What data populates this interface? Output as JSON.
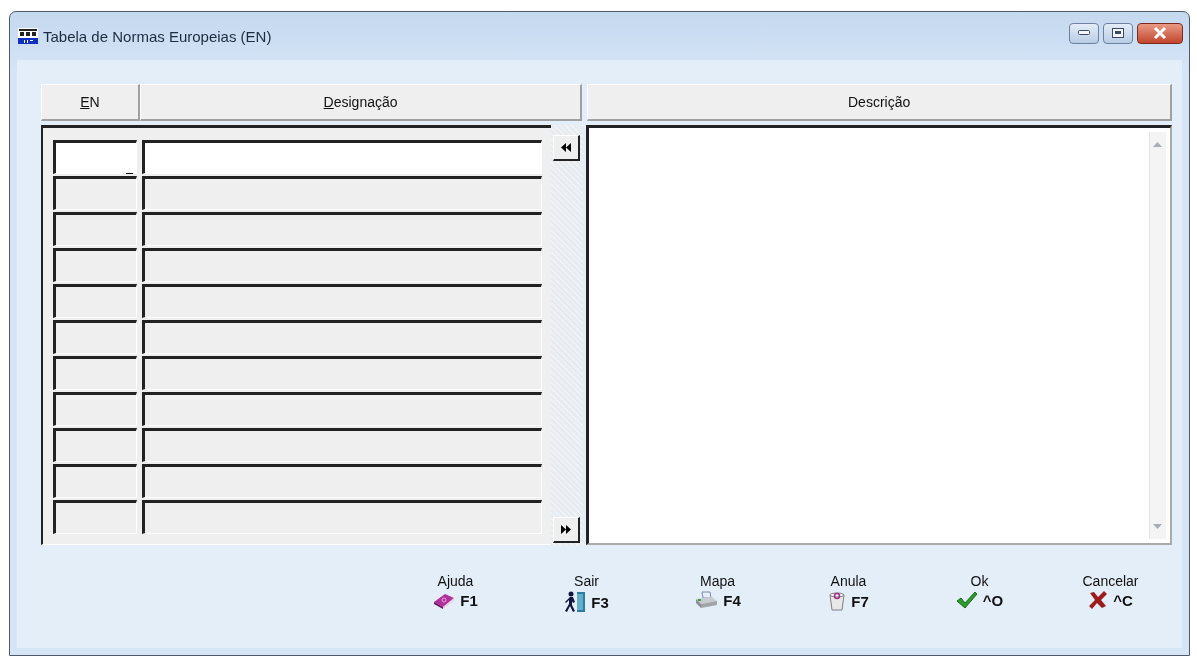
{
  "window": {
    "title": "Tabela de Normas Europeias (EN)"
  },
  "table": {
    "columns": [
      {
        "label": "EN",
        "underline_first": true
      },
      {
        "label": "Designação",
        "underline_first": true
      }
    ],
    "caret": "_",
    "rows": [
      {
        "selected": true
      },
      {
        "selected": false
      },
      {
        "selected": false
      },
      {
        "selected": false
      },
      {
        "selected": false
      },
      {
        "selected": false
      },
      {
        "selected": false
      },
      {
        "selected": false
      },
      {
        "selected": false
      },
      {
        "selected": false
      },
      {
        "selected": false
      }
    ]
  },
  "description": {
    "label": "Descrição",
    "underline_first": false
  },
  "buttons": [
    {
      "label": "Ajuda",
      "key": "F1",
      "kind": "help"
    },
    {
      "label": "Sair",
      "key": "F3",
      "kind": "exit"
    },
    {
      "label": "Mapa",
      "key": "F4",
      "kind": "print"
    },
    {
      "label": "Anula",
      "key": "F7",
      "kind": "discard"
    },
    {
      "label": "Ok",
      "key": "^O",
      "kind": "ok"
    },
    {
      "label": "Cancelar",
      "key": "^C",
      "kind": "cancel"
    }
  ]
}
